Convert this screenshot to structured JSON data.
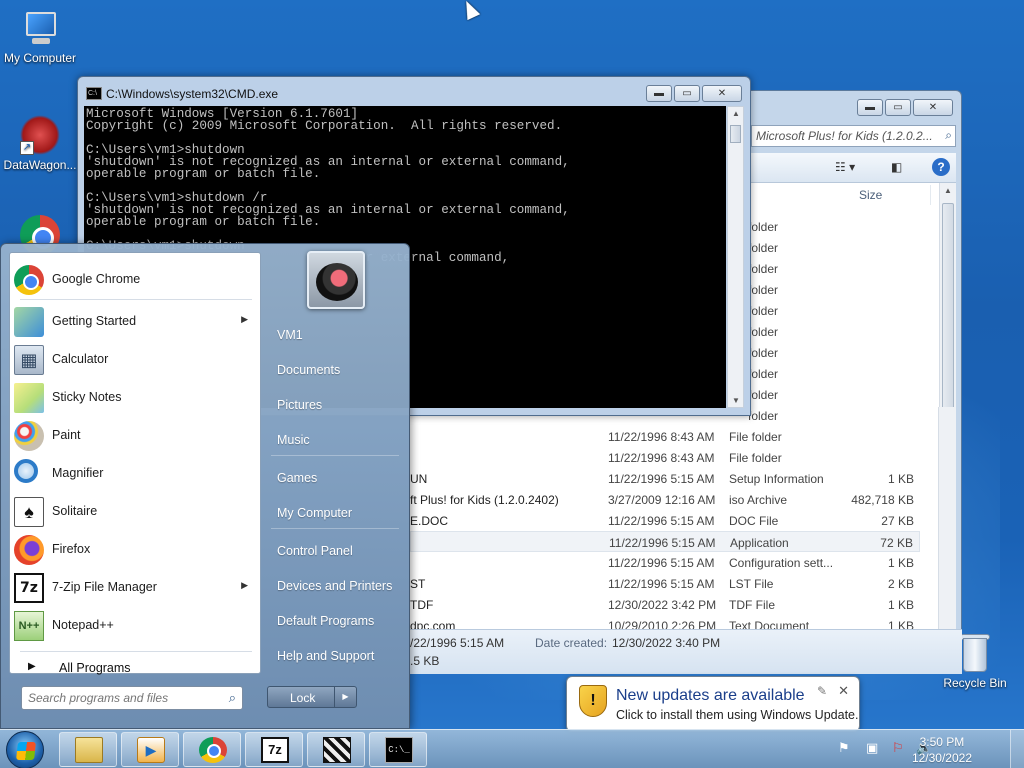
{
  "desktop": {
    "icons": [
      {
        "label": "My Computer",
        "icon": "computer-icon"
      },
      {
        "label": "DataWagon...",
        "icon": "datawagon-icon"
      },
      {
        "label": "",
        "icon": "chrome-icon"
      },
      {
        "label": "Recycle Bin",
        "icon": "recycle-bin-icon"
      }
    ]
  },
  "cmd_window": {
    "title": "C:\\Windows\\system32\\CMD.exe",
    "lines": [
      "Microsoft Windows [Version 6.1.7601]",
      "Copyright (c) 2009 Microsoft Corporation.  All rights reserved.",
      "",
      "C:\\Users\\vm1>shutdown",
      "'shutdown' is not recognized as an internal or external command,",
      "operable program or batch file.",
      "",
      "C:\\Users\\vm1>shutdown /r",
      "'shutdown' is not recognized as an internal or external command,",
      "operable program or batch file.",
      "",
      "C:\\Users\\vm1>shutdown",
      "                                 al or external command,"
    ],
    "buttons": {
      "minimize": "▬",
      "maximize": "▭",
      "close": "✕"
    }
  },
  "explorer_window": {
    "address": "Microsoft Plus! for Kids (1.2.0.2...",
    "columns": {
      "size": "Size"
    },
    "rows": [
      {
        "name": "",
        "date": "",
        "type": "folder",
        "size": ""
      },
      {
        "name": "",
        "date": "",
        "type": "folder",
        "size": ""
      },
      {
        "name": "",
        "date": "",
        "type": "folder",
        "size": ""
      },
      {
        "name": "",
        "date": "",
        "type": "folder",
        "size": ""
      },
      {
        "name": "",
        "date": "",
        "type": "folder",
        "size": ""
      },
      {
        "name": "",
        "date": "",
        "type": "folder",
        "size": ""
      },
      {
        "name": "",
        "date": "",
        "type": "folder",
        "size": ""
      },
      {
        "name": "",
        "date": "",
        "type": "folder",
        "size": ""
      },
      {
        "name": "",
        "date": "",
        "type": "folder",
        "size": ""
      },
      {
        "name": "",
        "date": "",
        "type": "folder",
        "size": ""
      },
      {
        "name": "",
        "date": "11/22/1996 8:43 AM",
        "type": "File folder",
        "size": ""
      },
      {
        "name": "",
        "date": "11/22/1996 8:43 AM",
        "type": "File folder",
        "size": ""
      },
      {
        "name": "UN",
        "date": "11/22/1996 5:15 AM",
        "type": "Setup Information",
        "size": "1 KB"
      },
      {
        "name": "ft Plus! for Kids (1.2.0.2402)",
        "date": "3/27/2009 12:16 AM",
        "type": "iso Archive",
        "size": "482,718 KB"
      },
      {
        "name": "E.DOC",
        "date": "11/22/1996 5:15 AM",
        "type": "DOC File",
        "size": "27 KB"
      },
      {
        "name": "",
        "date": "11/22/1996 5:15 AM",
        "type": "Application",
        "size": "72 KB"
      },
      {
        "name": "",
        "date": "11/22/1996 5:15 AM",
        "type": "Configuration sett...",
        "size": "1 KB"
      },
      {
        "name": "ST",
        "date": "11/22/1996 5:15 AM",
        "type": "LST File",
        "size": "2 KB"
      },
      {
        "name": "TDF",
        "date": "12/30/2022 3:42 PM",
        "type": "TDF File",
        "size": "1 KB"
      },
      {
        "name": "dpc.com",
        "date": "10/29/2010 2:26 PM",
        "type": "Text Document",
        "size": "1 KB"
      }
    ],
    "details": {
      "modified": "/22/1996 5:15 AM",
      "created_label": "Date created:",
      "created_value": "12/30/2022 3:40 PM",
      "size": ".5 KB"
    }
  },
  "start_menu": {
    "programs": [
      {
        "label": "Google Chrome",
        "icon": "chrome-icon",
        "arrow": false
      },
      {
        "label": "Getting Started",
        "icon": "getting-started-icon",
        "arrow": true
      },
      {
        "label": "Calculator",
        "icon": "calculator-icon",
        "arrow": false
      },
      {
        "label": "Sticky Notes",
        "icon": "sticky-notes-icon",
        "arrow": false
      },
      {
        "label": "Paint",
        "icon": "paint-icon",
        "arrow": false
      },
      {
        "label": "Magnifier",
        "icon": "magnifier-icon",
        "arrow": false
      },
      {
        "label": "Solitaire",
        "icon": "solitaire-icon",
        "arrow": false
      },
      {
        "label": "Firefox",
        "icon": "firefox-icon",
        "arrow": false
      },
      {
        "label": "7-Zip File Manager",
        "icon": "7zip-icon",
        "arrow": true
      },
      {
        "label": "Notepad++",
        "icon": "notepadpp-icon",
        "arrow": false
      }
    ],
    "all_programs": "All Programs",
    "search_placeholder": "Search programs and files",
    "right_items": [
      "VM1",
      "Documents",
      "Pictures",
      "Music",
      "Games",
      "My Computer",
      "Control Panel",
      "Devices and Printers",
      "Default Programs",
      "Help and Support"
    ],
    "lock_label": "Lock"
  },
  "notification": {
    "title": "New updates are available",
    "text": "Click to install them using Windows Update."
  },
  "taskbar": {
    "apps": [
      "explorer",
      "media-player",
      "chrome",
      "7-zip",
      "clapper",
      "cmd"
    ],
    "clock_time": "3:50 PM",
    "clock_date": "12/30/2022"
  }
}
